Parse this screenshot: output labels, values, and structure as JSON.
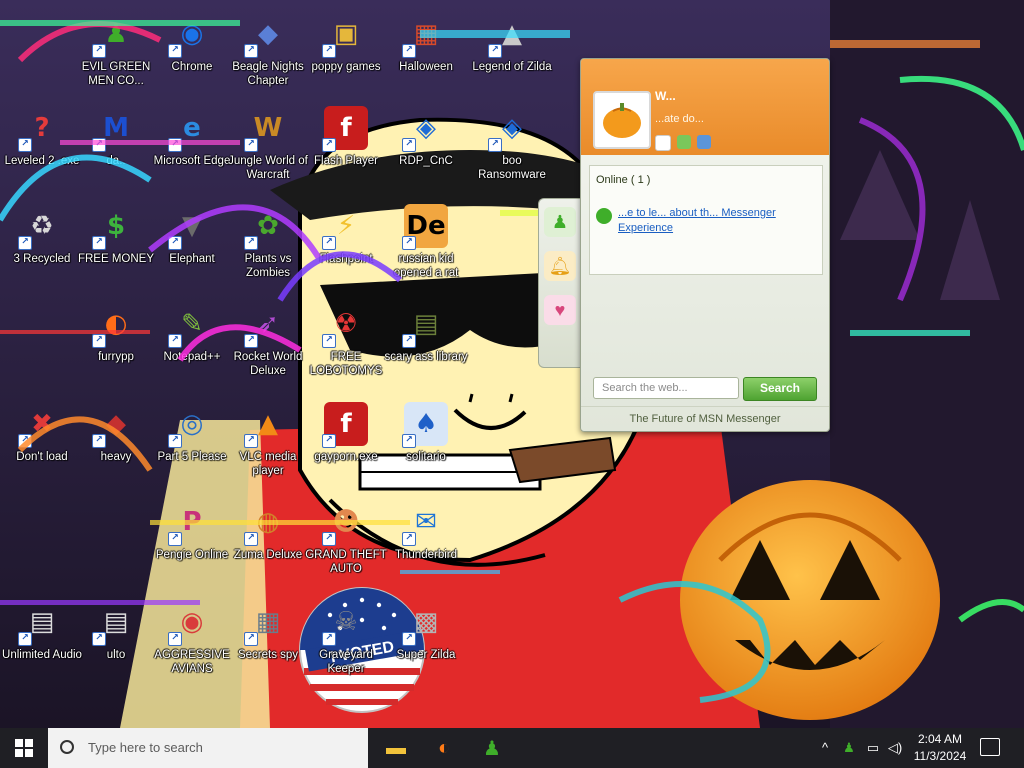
{
  "desktop": {
    "icons": [
      {
        "name": "EVIL GREEN MEN CO...",
        "glyph": "♟",
        "color": "#3fae2a",
        "bg": "transparent"
      },
      {
        "name": "Chrome",
        "glyph": "◉",
        "color": "#1a73e8",
        "bg": "transparent"
      },
      {
        "name": "Beagle Nights Chapter",
        "glyph": "◆",
        "color": "#5a7fd6",
        "bg": "transparent"
      },
      {
        "name": "poppy games",
        "glyph": "▣",
        "color": "#e5b73b",
        "bg": "transparent"
      },
      {
        "name": "Halloween",
        "glyph": "▦",
        "color": "#d84a2a",
        "bg": "transparent"
      },
      {
        "name": "Legend of Zilda",
        "glyph": "▲",
        "color": "#c9c9c9",
        "bg": "transparent"
      },
      {
        "name": "Leveled 2 .exe",
        "glyph": "?",
        "color": "#e53b3b",
        "bg": "transparent"
      },
      {
        "name": "da..",
        "glyph": "M",
        "color": "#1c4fd0",
        "bg": "transparent"
      },
      {
        "name": "Microsoft Edge",
        "glyph": "e",
        "color": "#2b8be0",
        "bg": "transparent"
      },
      {
        "name": "Jungle World of Warcraft",
        "glyph": "W",
        "color": "#c98a25",
        "bg": "transparent"
      },
      {
        "name": "Flash Player",
        "glyph": "f",
        "color": "#ffffff",
        "bg": "#c81d1d"
      },
      {
        "name": "RDP_CnC",
        "glyph": "◈",
        "color": "#1e6bd6",
        "bg": "transparent"
      },
      {
        "name": "boo Ransomware",
        "glyph": "◈",
        "color": "#1e6bd6",
        "bg": "transparent"
      },
      {
        "name": "3 Recycled",
        "glyph": "♻",
        "color": "#d7d7d7",
        "bg": "transparent"
      },
      {
        "name": "FREE MONEY",
        "glyph": "$",
        "color": "#3db33d",
        "bg": "transparent"
      },
      {
        "name": "Elephant",
        "glyph": "▼",
        "color": "#6b6b6b",
        "bg": "transparent"
      },
      {
        "name": "Plants vs Zombies",
        "glyph": "✿",
        "color": "#4aa82e",
        "bg": "transparent"
      },
      {
        "name": "Flashpoint",
        "glyph": "⚡",
        "color": "#f2c12e",
        "bg": "transparent"
      },
      {
        "name": "russian kid opened a rat",
        "glyph": "De",
        "color": "#000000",
        "bg": "#f1a640"
      },
      {
        "name": "furrypp",
        "glyph": "◐",
        "color": "#ff6d18",
        "bg": "transparent"
      },
      {
        "name": "Notepad++",
        "glyph": "✎",
        "color": "#7dbb3e",
        "bg": "transparent"
      },
      {
        "name": "Rocket World Deluxe",
        "glyph": "➶",
        "color": "#b04bd1",
        "bg": "transparent"
      },
      {
        "name": "FREE LOBOTOMYS",
        "glyph": "☢",
        "color": "#e53636",
        "bg": "transparent"
      },
      {
        "name": "scary ass library",
        "glyph": "▤",
        "color": "#6b7f3a",
        "bg": "transparent"
      },
      {
        "name": "Don't load",
        "glyph": "✖",
        "color": "#e03a3a",
        "bg": "transparent"
      },
      {
        "name": "heavy",
        "glyph": "◆",
        "color": "#c43030",
        "bg": "transparent"
      },
      {
        "name": "Part 5 Please",
        "glyph": "◎",
        "color": "#2a70c8",
        "bg": "transparent"
      },
      {
        "name": "VLC media player",
        "glyph": "▲",
        "color": "#f28a16",
        "bg": "transparent"
      },
      {
        "name": "gayporn.exe",
        "glyph": "f",
        "color": "#ffffff",
        "bg": "#c81d1d"
      },
      {
        "name": "solitario",
        "glyph": "♠",
        "color": "#1f60c8",
        "bg": "#d8e6f7"
      },
      {
        "name": "Pengie Online",
        "glyph": "P",
        "color": "#c8327a",
        "bg": "transparent"
      },
      {
        "name": "Zuma Deluxe",
        "glyph": "◍",
        "color": "#d2822a",
        "bg": "transparent"
      },
      {
        "name": "GRAND THEFT AUTO",
        "glyph": "☻",
        "color": "#e2884e",
        "bg": "transparent"
      },
      {
        "name": "Thunderbird",
        "glyph": "✉",
        "color": "#1f74d6",
        "bg": "transparent"
      },
      {
        "name": "Unlimited Audio",
        "glyph": "▤",
        "color": "#dcdcdc",
        "bg": "transparent"
      },
      {
        "name": "ulto",
        "glyph": "▤",
        "color": "#dcdcdc",
        "bg": "transparent"
      },
      {
        "name": "AGGRESSIVE AVIANS",
        "glyph": "◉",
        "color": "#d93b3b",
        "bg": "transparent"
      },
      {
        "name": "Secrets spy",
        "glyph": "▦",
        "color": "#6b7c8a",
        "bg": "transparent"
      },
      {
        "name": "Graveyard Keeper",
        "glyph": "☠",
        "color": "#8a8a8a",
        "bg": "transparent"
      },
      {
        "name": "Super Zilda",
        "glyph": "▩",
        "color": "#b5b5b5",
        "bg": "transparent"
      }
    ]
  },
  "msn": {
    "user_name": "W...",
    "status": "...ate do...",
    "online_group": "Online ( 1 )",
    "welcome_link": "...e to le... about th... Messenger Experience",
    "search_placeholder": "Search the web...",
    "search_button": "Search",
    "footer": "The Future of MSN Messenger",
    "colors": {
      "header": "#ef952f",
      "search": "#4ea331"
    }
  },
  "taskbar": {
    "search_placeholder": "Type here to search",
    "time": "2:04 AM",
    "date": "11/3/2024",
    "pinned": [
      {
        "name": "File Explorer",
        "glyph": "▬",
        "color": "#f2c33b"
      },
      {
        "name": "Firefox",
        "glyph": "◐",
        "color": "#ff7b17"
      },
      {
        "name": "MSN Messenger",
        "glyph": "♟",
        "color": "#3fae2a"
      }
    ]
  },
  "wallpaper": {
    "sticker_text": "I VOTED",
    "colors": {
      "red": "#e22a2a",
      "skin": "#fff2b3",
      "pumpkin": "#f59d16"
    }
  }
}
